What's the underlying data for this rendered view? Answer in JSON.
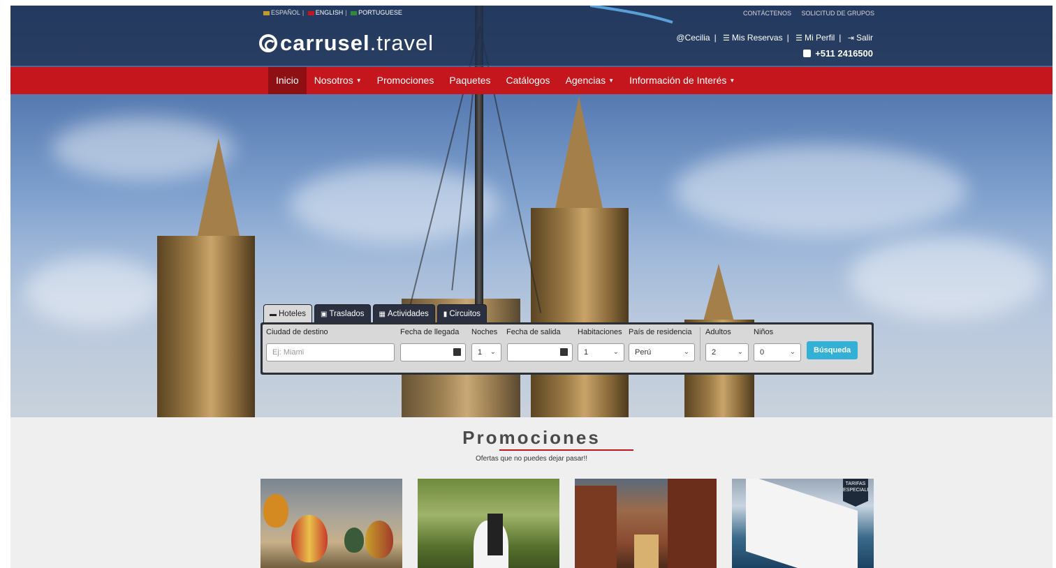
{
  "languages": [
    {
      "label": "ESPAÑOL",
      "flag_color": "#c49a2a"
    },
    {
      "label": "ENGLISH",
      "flag_color": "#c4161c"
    },
    {
      "label": "PORTUGUESE",
      "flag_color": "#2e8b3a"
    }
  ],
  "top_links": {
    "contact": "CONTÁCTENOS",
    "groups": "SOLICITUD DE GRUPOS"
  },
  "logo": {
    "bold": "carrusel",
    "light": ".travel"
  },
  "user_nav": {
    "user": "@Cecilia",
    "reservas": "Mis Reservas",
    "perfil": "Mi Perfil",
    "salir": "Salir",
    "phone": "+511 2416500"
  },
  "menu": [
    {
      "label": "Inicio",
      "active": true,
      "dropdown": false
    },
    {
      "label": "Nosotros",
      "active": false,
      "dropdown": true
    },
    {
      "label": "Promociones",
      "active": false,
      "dropdown": false
    },
    {
      "label": "Paquetes",
      "active": false,
      "dropdown": false
    },
    {
      "label": "Catálogos",
      "active": false,
      "dropdown": false
    },
    {
      "label": "Agencias",
      "active": false,
      "dropdown": true
    },
    {
      "label": "Información de Interés",
      "active": false,
      "dropdown": true
    }
  ],
  "search": {
    "tabs": [
      "Hoteles",
      "Traslados",
      "Actividades",
      "Circuitos"
    ],
    "labels": {
      "city": "Ciudad de destino",
      "arrival": "Fecha de llegada",
      "nights": "Noches",
      "departure": "Fecha de salida",
      "rooms": "Habitaciones",
      "country": "País de residencia",
      "adults": "Adultos",
      "children": "Niños"
    },
    "city_placeholder": "Ej: Miami",
    "nights_value": "1",
    "rooms_value": "1",
    "country_value": "Perú",
    "adults_value": "2",
    "children_value": "0",
    "button": "Búsqueda"
  },
  "promos": {
    "title": "Promociones",
    "subtitle": "Ofertas que no puedes dejar pasar!!",
    "badge": "TARIFAS ESPECIALES"
  },
  "colors": {
    "brand_red": "#c4161c",
    "header_navy": "#203252",
    "search_button": "#33b0d6"
  }
}
